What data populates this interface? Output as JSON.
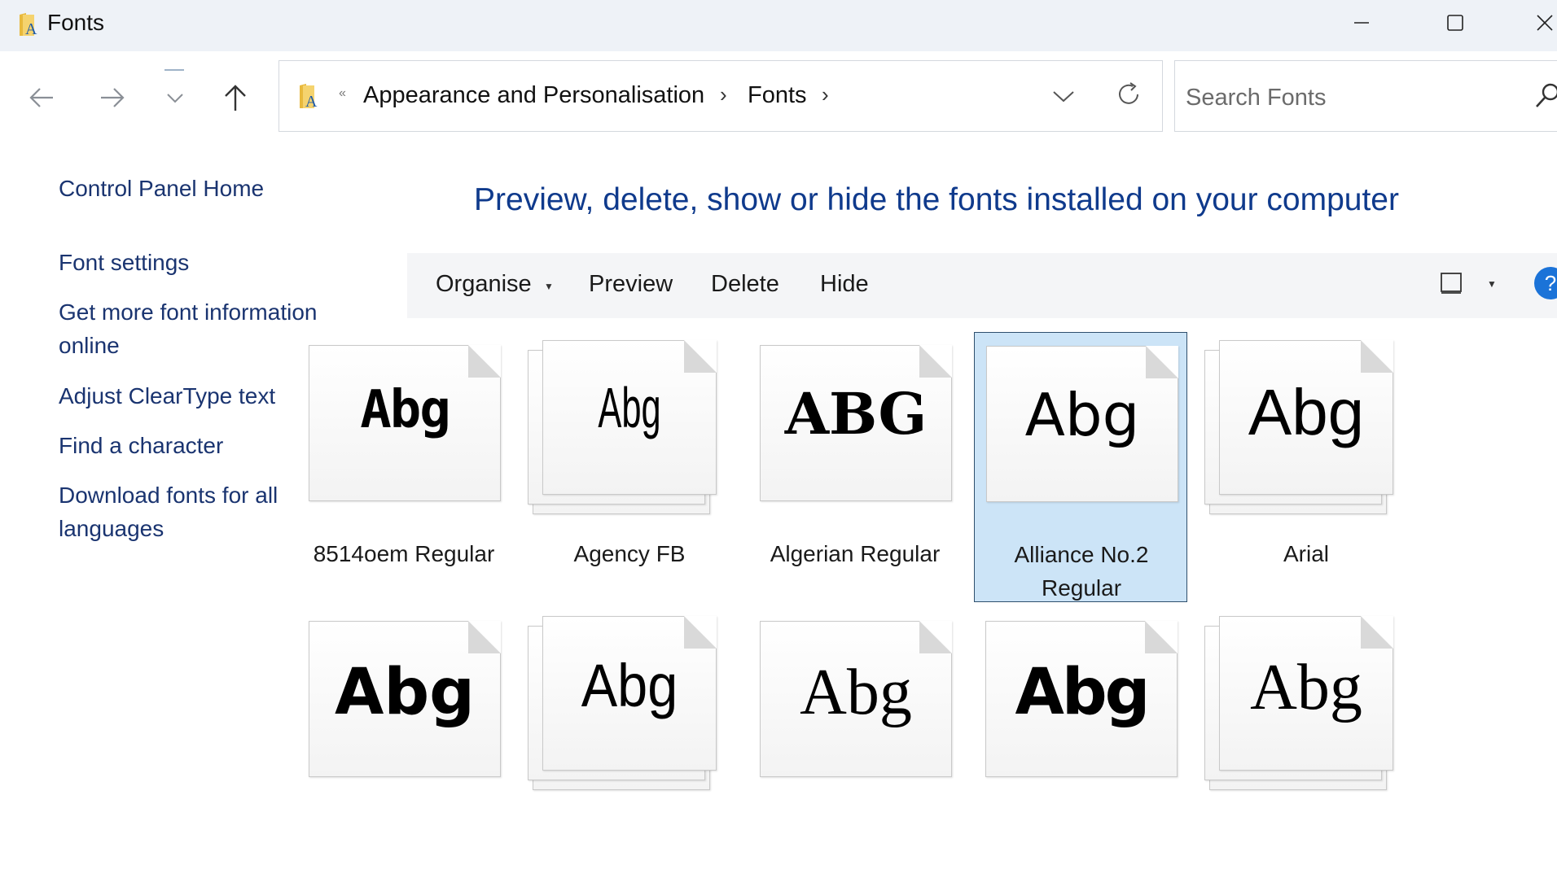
{
  "window": {
    "title": "Fonts"
  },
  "address_bar": {
    "overflow": "«",
    "breadcrumb": [
      "Appearance and Personalisation",
      "Fonts"
    ],
    "separator": "›"
  },
  "search": {
    "placeholder": "Search Fonts",
    "value": ""
  },
  "sidebar": {
    "items": [
      "Control Panel Home",
      "Font settings",
      "Get more font information online",
      "Adjust ClearType text",
      "Find a character",
      "Download fonts for all languages"
    ]
  },
  "main": {
    "heading": "Preview, delete, show or hide the fonts installed on your computer"
  },
  "toolbar": {
    "organise": "Organise",
    "preview": "Preview",
    "delete": "Delete",
    "hide": "Hide",
    "help": "?"
  },
  "fonts": [
    {
      "name": "8514oem Regular",
      "sample": "Abg",
      "family_count": "single",
      "selected": false
    },
    {
      "name": "Agency FB",
      "sample": "Abg",
      "family_count": "multiple",
      "selected": false
    },
    {
      "name": "Algerian Regular",
      "sample": "ABG",
      "family_count": "single",
      "selected": false
    },
    {
      "name": "Alliance No.2 Regular",
      "sample": "Abg",
      "family_count": "single",
      "selected": true
    },
    {
      "name": "Arial",
      "sample": "Abg",
      "family_count": "multiple",
      "selected": false
    },
    {
      "name": "",
      "sample": "Abg",
      "family_count": "single",
      "selected": false
    },
    {
      "name": "",
      "sample": "Abg",
      "family_count": "multiple",
      "selected": false
    },
    {
      "name": "",
      "sample": "Abg",
      "family_count": "single",
      "selected": false
    },
    {
      "name": "",
      "sample": "Abg",
      "family_count": "single",
      "selected": false
    },
    {
      "name": "",
      "sample": "Abg",
      "family_count": "multiple",
      "selected": false
    }
  ],
  "colors": {
    "titlebar": "#eef2f7",
    "link": "#1a3470",
    "heading": "#0f3a8c",
    "selection": "#cce4f7",
    "help": "#1b73d8"
  },
  "icons": {
    "app": "fonts-folder-icon",
    "minimize": "minimize-icon",
    "maximize": "maximize-icon",
    "close": "close-icon",
    "back": "arrow-left-icon",
    "forward": "arrow-right-icon",
    "recent": "chevron-down-icon",
    "up": "arrow-up-icon",
    "refresh": "refresh-icon",
    "search": "search-icon",
    "view": "view-pane-icon",
    "help": "help-icon"
  }
}
